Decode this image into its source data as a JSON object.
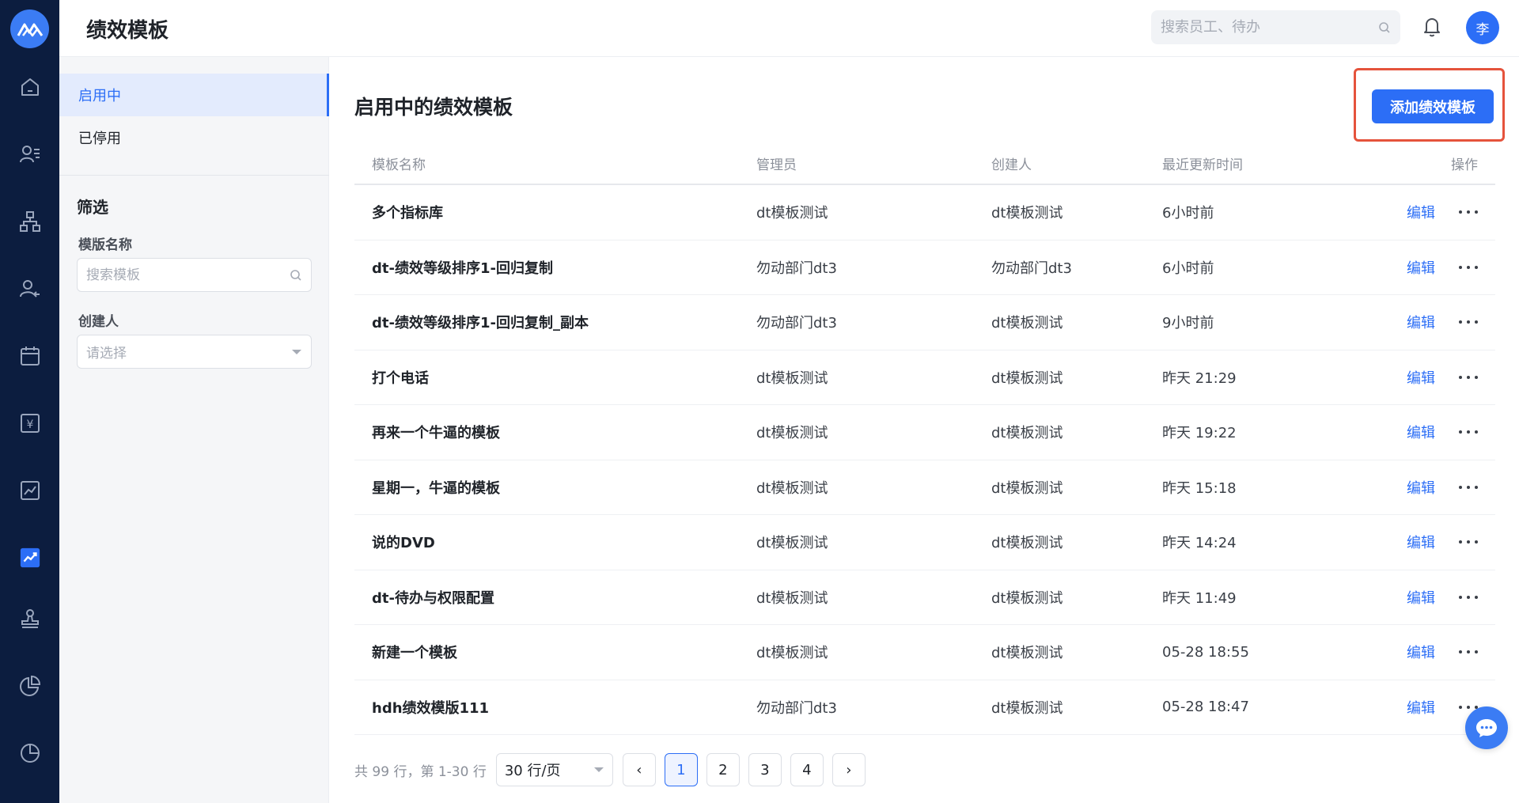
{
  "header": {
    "title": "绩效模板",
    "search_placeholder": "搜索员工、待办",
    "avatar_text": "李"
  },
  "nav": {
    "icons": [
      "home-icon",
      "employee-list-icon",
      "org-chart-icon",
      "user-leave-icon",
      "calendar-icon",
      "salary-icon",
      "report-icon",
      "performance-icon",
      "stamp-icon",
      "pie-chart-icon",
      "analytics-icon"
    ],
    "active_index": 7,
    "accent": "#2c6ef6",
    "bg": "#0c1d3f"
  },
  "sidebar": {
    "items": [
      {
        "label": "启用中"
      },
      {
        "label": "已停用"
      }
    ],
    "filter_title": "筛选",
    "template_name_label": "模版名称",
    "template_name_placeholder": "搜索模板",
    "creator_label": "创建人",
    "creator_placeholder": "请选择"
  },
  "main": {
    "title": "启用中的绩效模板",
    "add_button": "添加绩效模板",
    "columns": [
      "模板名称",
      "管理员",
      "创建人",
      "最近更新时间",
      "操作"
    ],
    "edit_label": "编辑",
    "rows": [
      {
        "name": "多个指标库",
        "admin": "dt模板测试",
        "creator": "dt模板测试",
        "updated": "6小时前"
      },
      {
        "name": "dt-绩效等级排序1-回归复制",
        "admin": "勿动部门dt3",
        "creator": "勿动部门dt3",
        "updated": "6小时前"
      },
      {
        "name": "dt-绩效等级排序1-回归复制_副本",
        "admin": "勿动部门dt3",
        "creator": "dt模板测试",
        "updated": "9小时前"
      },
      {
        "name": "打个电话",
        "admin": "dt模板测试",
        "creator": "dt模板测试",
        "updated": "昨天 21:29"
      },
      {
        "name": "再来一个牛逼的模板",
        "admin": "dt模板测试",
        "creator": "dt模板测试",
        "updated": "昨天 19:22"
      },
      {
        "name": "星期一，牛逼的模板",
        "admin": "dt模板测试",
        "creator": "dt模板测试",
        "updated": "昨天 15:18"
      },
      {
        "name": "说的DVD",
        "admin": "dt模板测试",
        "creator": "dt模板测试",
        "updated": "昨天 14:24"
      },
      {
        "name": "dt-待办与权限配置",
        "admin": "dt模板测试",
        "creator": "dt模板测试",
        "updated": "昨天 11:49"
      },
      {
        "name": "新建一个模板",
        "admin": "dt模板测试",
        "creator": "dt模板测试",
        "updated": "05-28 18:55"
      },
      {
        "name": "hdh绩效模版111",
        "admin": "勿动部门dt3",
        "creator": "dt模板测试",
        "updated": "05-28 18:47"
      }
    ]
  },
  "pagination": {
    "summary": "共 99 行，第 1-30 行",
    "page_size": "30 行/页",
    "prev": "‹",
    "next": "›",
    "pages": [
      "1",
      "2",
      "3",
      "4"
    ],
    "current": "1"
  }
}
